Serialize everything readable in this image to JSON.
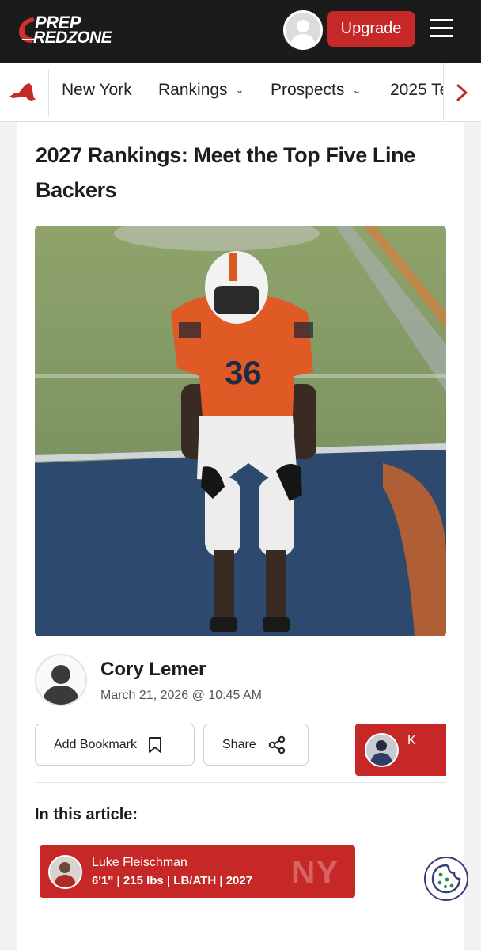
{
  "header": {
    "logo_line1": "PREP",
    "logo_line2": "REDZONE",
    "upgrade_label": "Upgrade",
    "accent": "#c62828",
    "bg": "#1b1b1b"
  },
  "nav": {
    "items": [
      {
        "label": "New York",
        "has_dropdown": false
      },
      {
        "label": "Rankings",
        "has_dropdown": true
      },
      {
        "label": "Prospects",
        "has_dropdown": true
      },
      {
        "label": "2025 Te",
        "has_dropdown": false
      }
    ],
    "state_icon": "new-york-state-icon",
    "scroll_icon": "chevron-right-icon"
  },
  "article": {
    "title": "2027 Rankings: Meet the Top Five Line Backers",
    "hero_jersey_number": "36",
    "author_name": "Cory Lemer",
    "date": "March 21, 2026 @ 10:45 AM",
    "bookmark_label": "Add Bookmark",
    "share_label": "Share",
    "in_article_heading": "In this article:"
  },
  "players": [
    {
      "name": "Luke Fleischman",
      "meta": "6'1\" | 215 lbs | LB/ATH | 2027",
      "state": "NY"
    },
    {
      "name_truncated": "K"
    }
  ]
}
